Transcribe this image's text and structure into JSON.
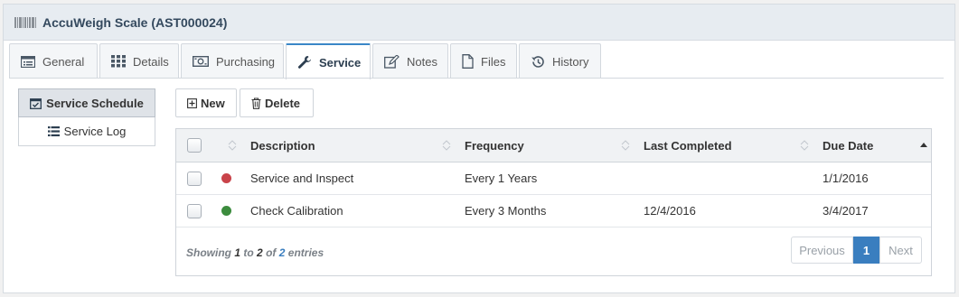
{
  "panel": {
    "title": "AccuWeigh Scale (AST000024)",
    "icon": "barcode-icon"
  },
  "tabs": [
    {
      "label": "General",
      "icon": "list-alt-icon",
      "active": false
    },
    {
      "label": "Details",
      "icon": "grid-icon",
      "active": false
    },
    {
      "label": "Purchasing",
      "icon": "money-icon",
      "active": false
    },
    {
      "label": "Service",
      "icon": "wrench-icon",
      "active": true
    },
    {
      "label": "Notes",
      "icon": "edit-icon",
      "active": false
    },
    {
      "label": "Files",
      "icon": "file-icon",
      "active": false
    },
    {
      "label": "History",
      "icon": "history-icon",
      "active": false
    }
  ],
  "side_nav": {
    "schedule_label": "Service Schedule",
    "log_label": "Service Log"
  },
  "toolbar": {
    "new_label": "New",
    "delete_label": "Delete"
  },
  "table": {
    "columns": {
      "description": "Description",
      "frequency": "Frequency",
      "last_completed": "Last Completed",
      "due_date": "Due Date"
    },
    "rows": [
      {
        "status_color": "#c9434a",
        "description": "Service and Inspect",
        "frequency": "Every 1 Years",
        "last_completed": "",
        "due_date": "1/1/2016"
      },
      {
        "status_color": "#3c8c3e",
        "description": "Check Calibration",
        "frequency": "Every 3 Months",
        "last_completed": "12/4/2016",
        "due_date": "3/4/2017"
      }
    ]
  },
  "footer": {
    "showing_prefix": "Showing",
    "from": "1",
    "to_word": "to",
    "to": "2",
    "of_word": "of",
    "total": "2",
    "entries_word": "entries"
  },
  "pagination": {
    "previous_label": "Previous",
    "current_page": "1",
    "next_label": "Next"
  },
  "colors": {
    "accent": "#3a7ebf",
    "header_bg": "#e7ecf1"
  }
}
